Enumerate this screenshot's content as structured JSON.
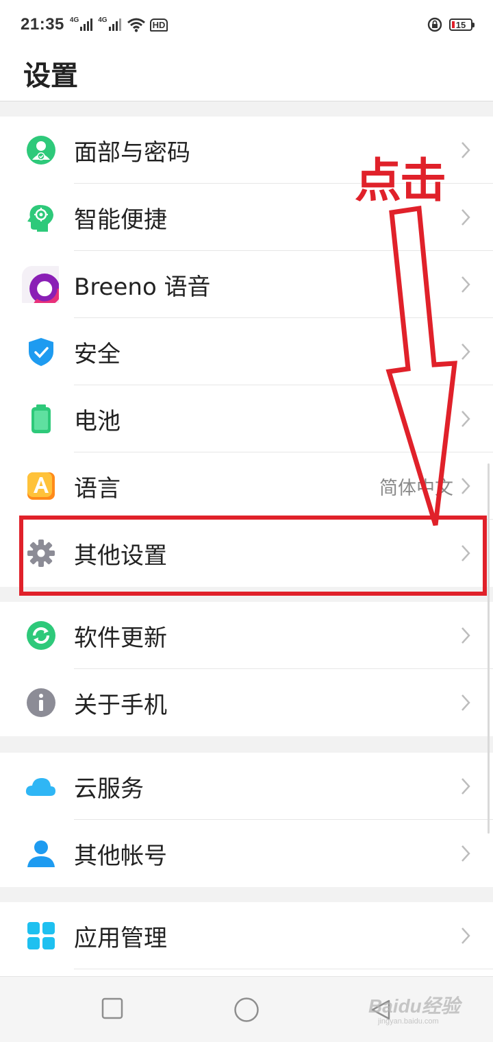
{
  "status_bar": {
    "time": "21:35",
    "network1": "4G",
    "network2": "4G",
    "hd_label": "HD",
    "battery_level": "15",
    "battery_color": "#e0212a"
  },
  "header": {
    "title": "设置"
  },
  "settings": {
    "face_password": {
      "label": "面部与密码",
      "icon": "face-lock-icon"
    },
    "smart_convenience": {
      "label": "智能便捷",
      "icon": "smart-head-icon"
    },
    "breeno": {
      "label": "Breeno 语音",
      "icon": "breeno-icon"
    },
    "security": {
      "label": "安全",
      "icon": "shield-icon"
    },
    "battery": {
      "label": "电池",
      "icon": "battery-icon"
    },
    "language": {
      "label": "语言",
      "value": "简体中文",
      "icon": "language-icon"
    },
    "other_settings": {
      "label": "其他设置",
      "icon": "gear-icon"
    },
    "software_update": {
      "label": "软件更新",
      "icon": "update-icon"
    },
    "about_phone": {
      "label": "关于手机",
      "icon": "info-icon"
    },
    "cloud_service": {
      "label": "云服务",
      "icon": "cloud-icon"
    },
    "other_accounts": {
      "label": "其他帐号",
      "icon": "person-icon"
    },
    "app_management": {
      "label": "应用管理",
      "icon": "apps-grid-icon"
    }
  },
  "annotation": {
    "text": "点击",
    "color": "#e0212a"
  },
  "watermark": {
    "brand": "Baidu经验",
    "url": "jingyan.baidu.com"
  },
  "colors": {
    "accent_red": "#e0212a",
    "green": "#2ec97a",
    "blue": "#1e9bf0",
    "orange": "#ffb020"
  }
}
